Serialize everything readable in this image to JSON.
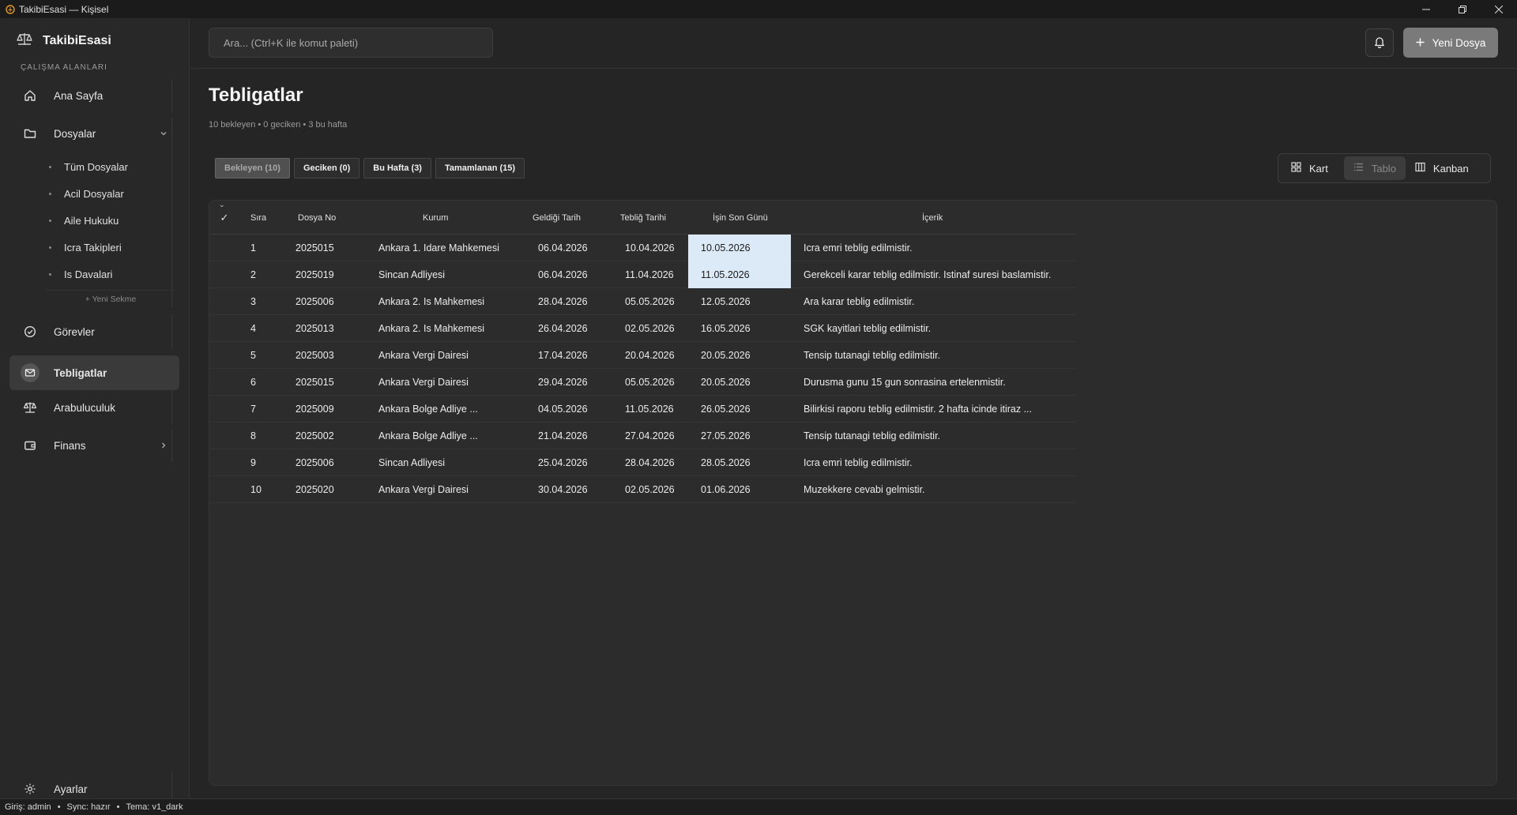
{
  "window": {
    "title": "TakibiEsasi — Kişisel",
    "app_icon": "scales-icon",
    "controls": [
      "minimize",
      "restore",
      "close"
    ]
  },
  "sidebar": {
    "brand": "TakibiEsasi",
    "section_label": "ÇALIŞMA ALANLARI",
    "items": [
      {
        "label": "Ana Sayfa",
        "icon": "home-icon"
      },
      {
        "label": "Dosyalar",
        "icon": "folder-icon",
        "expanded": true
      },
      {
        "label": "Görevler",
        "icon": "check-circle-icon"
      },
      {
        "label": "Tebligatlar",
        "icon": "mail-icon",
        "active": true
      },
      {
        "label": "Arabuluculuk",
        "icon": "scales-icon"
      },
      {
        "label": "Finans",
        "icon": "wallet-icon"
      }
    ],
    "sub_items": [
      "Tüm Dosyalar",
      "Acil Dosyalar",
      "Aile Hukuku",
      "Icra Takipleri",
      "Is Davalari"
    ],
    "new_tab": "+ Yeni Sekme",
    "settings": "Ayarlar"
  },
  "topbar": {
    "search_placeholder": "Ara...   (Ctrl+K ile komut paleti)",
    "new_file_label": "Yeni Dosya"
  },
  "page": {
    "title": "Tebligatlar",
    "subtitle": "10 bekleyen • 0 geciken • 3 bu hafta"
  },
  "filters": [
    {
      "label": "Bekleyen (10)",
      "active": true
    },
    {
      "label": "Geciken (0)"
    },
    {
      "label": "Bu Hafta (3)"
    },
    {
      "label": "Tamamlanan (15)"
    }
  ],
  "views": [
    {
      "label": "Kart",
      "icon": "grid-icon"
    },
    {
      "label": "Tablo",
      "icon": "list-icon",
      "active": true
    },
    {
      "label": "Kanban",
      "icon": "columns-icon"
    }
  ],
  "table": {
    "columns": [
      "✓",
      "Sıra",
      "Dosya No",
      "Kurum",
      "Geldiği Tarih",
      "Tebliğ Tarihi",
      "İşin Son Günü",
      "İçerik"
    ],
    "rows": [
      [
        "1",
        "2025015",
        "Ankara 1. Idare Mahkemesi",
        "06.04.2026",
        "10.04.2026",
        "10.05.2026",
        "Icra emri teblig edilmistir."
      ],
      [
        "2",
        "2025019",
        "Sincan Adliyesi",
        "06.04.2026",
        "11.04.2026",
        "11.05.2026",
        "Gerekceli karar teblig edilmistir. Istinaf suresi baslamistir."
      ],
      [
        "3",
        "2025006",
        "Ankara 2. Is Mahkemesi",
        "28.04.2026",
        "05.05.2026",
        "12.05.2026",
        "Ara karar teblig edilmistir."
      ],
      [
        "4",
        "2025013",
        "Ankara 2. Is Mahkemesi",
        "26.04.2026",
        "02.05.2026",
        "16.05.2026",
        "SGK kayitlari teblig edilmistir."
      ],
      [
        "5",
        "2025003",
        "Ankara Vergi Dairesi",
        "17.04.2026",
        "20.04.2026",
        "20.05.2026",
        "Tensip tutanagi teblig edilmistir."
      ],
      [
        "6",
        "2025015",
        "Ankara Vergi Dairesi",
        "29.04.2026",
        "05.05.2026",
        "20.05.2026",
        "Durusma gunu 15 gun sonrasina ertelenmistir."
      ],
      [
        "7",
        "2025009",
        "Ankara Bolge Adliye ...",
        "04.05.2026",
        "11.05.2026",
        "26.05.2026",
        "Bilirkisi raporu teblig edilmistir. 2 hafta icinde itiraz ..."
      ],
      [
        "8",
        "2025002",
        "Ankara Bolge Adliye ...",
        "21.04.2026",
        "27.04.2026",
        "27.05.2026",
        "Tensip tutanagi teblig edilmistir."
      ],
      [
        "9",
        "2025006",
        "Sincan Adliyesi",
        "25.04.2026",
        "28.04.2026",
        "28.05.2026",
        "Icra emri teblig edilmistir."
      ],
      [
        "10",
        "2025020",
        "Ankara Vergi Dairesi",
        "30.04.2026",
        "02.05.2026",
        "01.06.2026",
        "Muzekkere cevabi gelmistir."
      ]
    ],
    "highlighted_rows": [
      0,
      1
    ],
    "highlight_color": "#dceaf7"
  },
  "status": {
    "login": "Giriş: admin",
    "sync": "Sync: hazır",
    "theme": "Tema: v1_dark"
  }
}
